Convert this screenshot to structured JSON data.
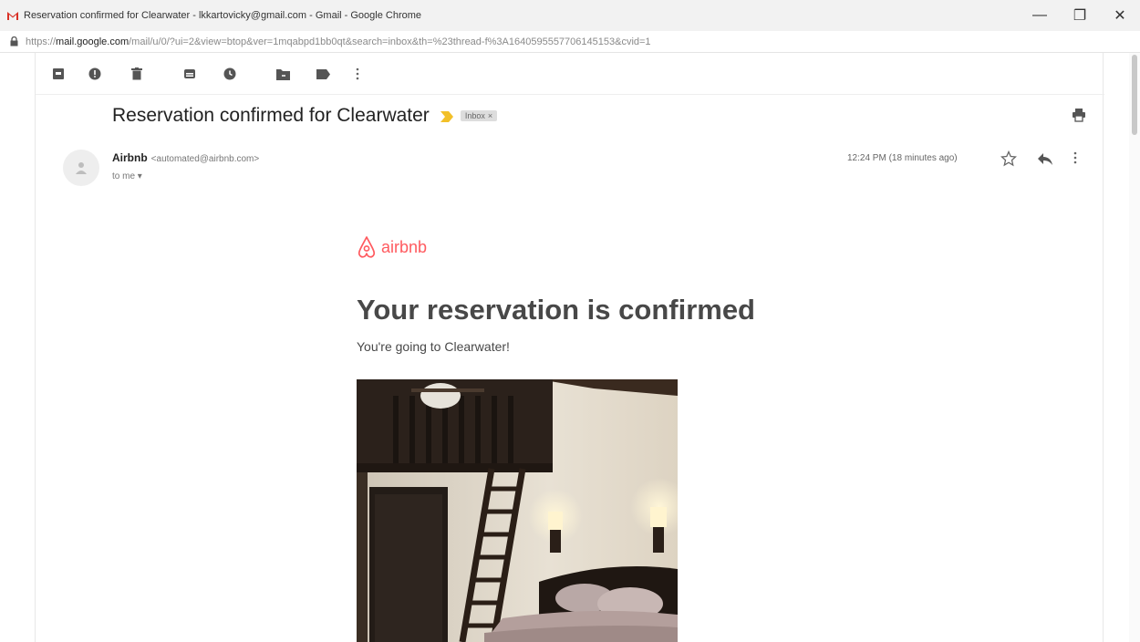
{
  "window": {
    "title": "Reservation confirmed for Clearwater - lkkartovicky@gmail.com - Gmail - Google Chrome",
    "minimize_symbol": "—",
    "maximize_symbol": "❐",
    "close_symbol": "✕"
  },
  "addressbar": {
    "scheme": "https://",
    "host": "mail.google.com",
    "path": "/mail/u/0/?ui=2&view=btop&ver=1mqabpd1bb0qt&search=inbox&th=%23thread-f%3A1640595557706145153&cvid=1"
  },
  "toolbar": {
    "buttons": [
      "archive-icon",
      "report-spam-icon",
      "delete-icon",
      "mark-unread-icon",
      "snooze-icon",
      "move-to-icon",
      "labels-icon",
      "more-vert-icon"
    ]
  },
  "email": {
    "subject": "Reservation confirmed for Clearwater",
    "label": "Inbox",
    "label_remove": "×",
    "sender_name": "Airbnb",
    "sender_email": "<automated@airbnb.com>",
    "to": "to me ▾",
    "time": "12:24 PM (18 minutes ago)"
  },
  "body": {
    "logo_text": "airbnb",
    "headline": "Your reservation is confirmed",
    "subline": "You're going to Clearwater!"
  },
  "colors": {
    "brand": "#ff5a5f",
    "importance": "#f2c029"
  }
}
